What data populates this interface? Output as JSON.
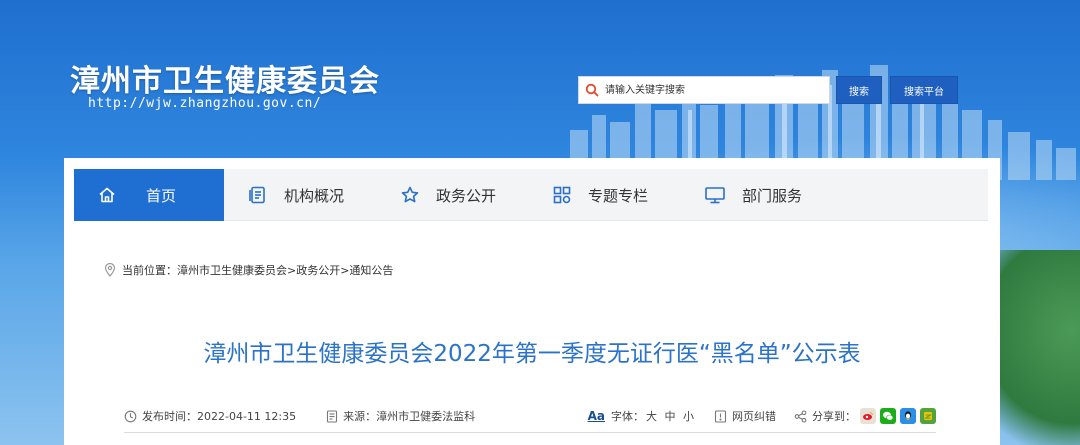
{
  "header": {
    "site_title": "漳州市卫生健康委员会",
    "site_url": "http://wjw.zhangzhou.gov.cn/"
  },
  "search": {
    "placeholder": "请输入关键字搜索",
    "search_button": "搜索",
    "platform_button": "搜索平台"
  },
  "nav": {
    "items": [
      {
        "label": "首页",
        "icon": "home-icon"
      },
      {
        "label": "机构概况",
        "icon": "document-list-icon"
      },
      {
        "label": "政务公开",
        "icon": "star-icon"
      },
      {
        "label": "专题专栏",
        "icon": "grid-icon"
      },
      {
        "label": "部门服务",
        "icon": "monitor-icon"
      }
    ]
  },
  "breadcrumb": {
    "prefix": "当前位置：",
    "path": "漳州市卫生健康委员会>政务公开>通知公告"
  },
  "article": {
    "title": "漳州市卫生健康委员会2022年第一季度无证行医“黑名单”公示表",
    "publish_label": "发布时间：",
    "publish_time": "2022-04-11 12:35",
    "source_label": "来源：",
    "source": "漳州市卫健委法监科",
    "font_aa": "Aa",
    "font_label": "字体：",
    "font_large": "大",
    "font_medium": "中",
    "font_small": "小",
    "error_label": "网页纠错",
    "share_label": "分享到："
  },
  "colors": {
    "accent": "#1f6fd2",
    "title_blue": "#2b73c8"
  }
}
